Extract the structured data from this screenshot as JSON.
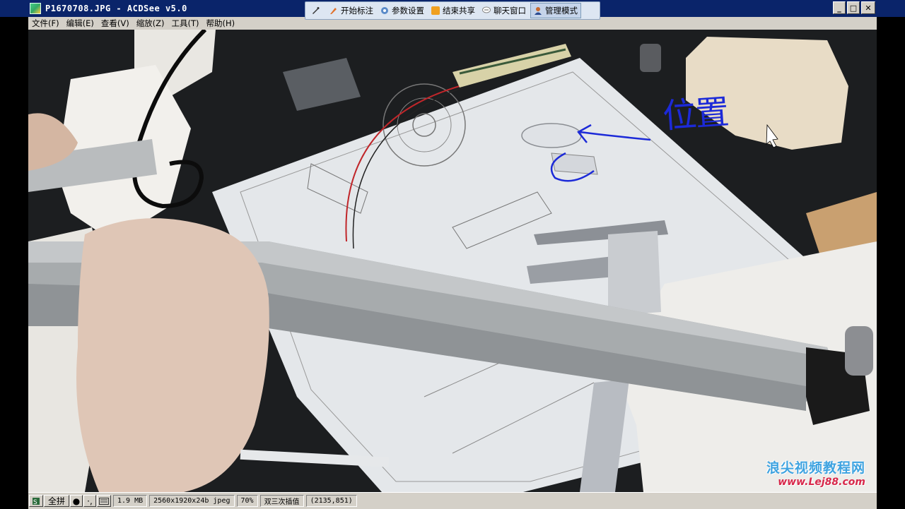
{
  "window": {
    "title": "P1670708.JPG - ACDSee v5.0",
    "minimize": "_",
    "maximize": "□",
    "close": "✕"
  },
  "sharebar": {
    "items": [
      {
        "label": "",
        "icon": "pen-icon"
      },
      {
        "label": "开始标注",
        "icon": "marker-icon"
      },
      {
        "label": "参数设置",
        "icon": "settings-icon"
      },
      {
        "label": "结束共享",
        "icon": "stop-share-icon"
      },
      {
        "label": "聊天窗口",
        "icon": "chat-icon"
      },
      {
        "label": "管理模式",
        "icon": "user-icon"
      }
    ]
  },
  "menu": {
    "items": [
      "文件(F)",
      "编辑(E)",
      "查看(V)",
      "缩放(Z)",
      "工具(T)",
      "帮助(H)"
    ]
  },
  "annotation": {
    "text": "位置",
    "color": "#1c2ad8"
  },
  "statusbar": {
    "full_label": "全拼",
    "dot_label": "●",
    "punct_label": "·,",
    "filesize": "1.9 MB",
    "imageinfo": "2560x1920x24b jpeg",
    "zoom": "70%",
    "interp": "双三次插值",
    "coords": "(2135,851)"
  },
  "watermark": {
    "name": "浪尖视频教程网",
    "url": "www.Lej88.com"
  }
}
